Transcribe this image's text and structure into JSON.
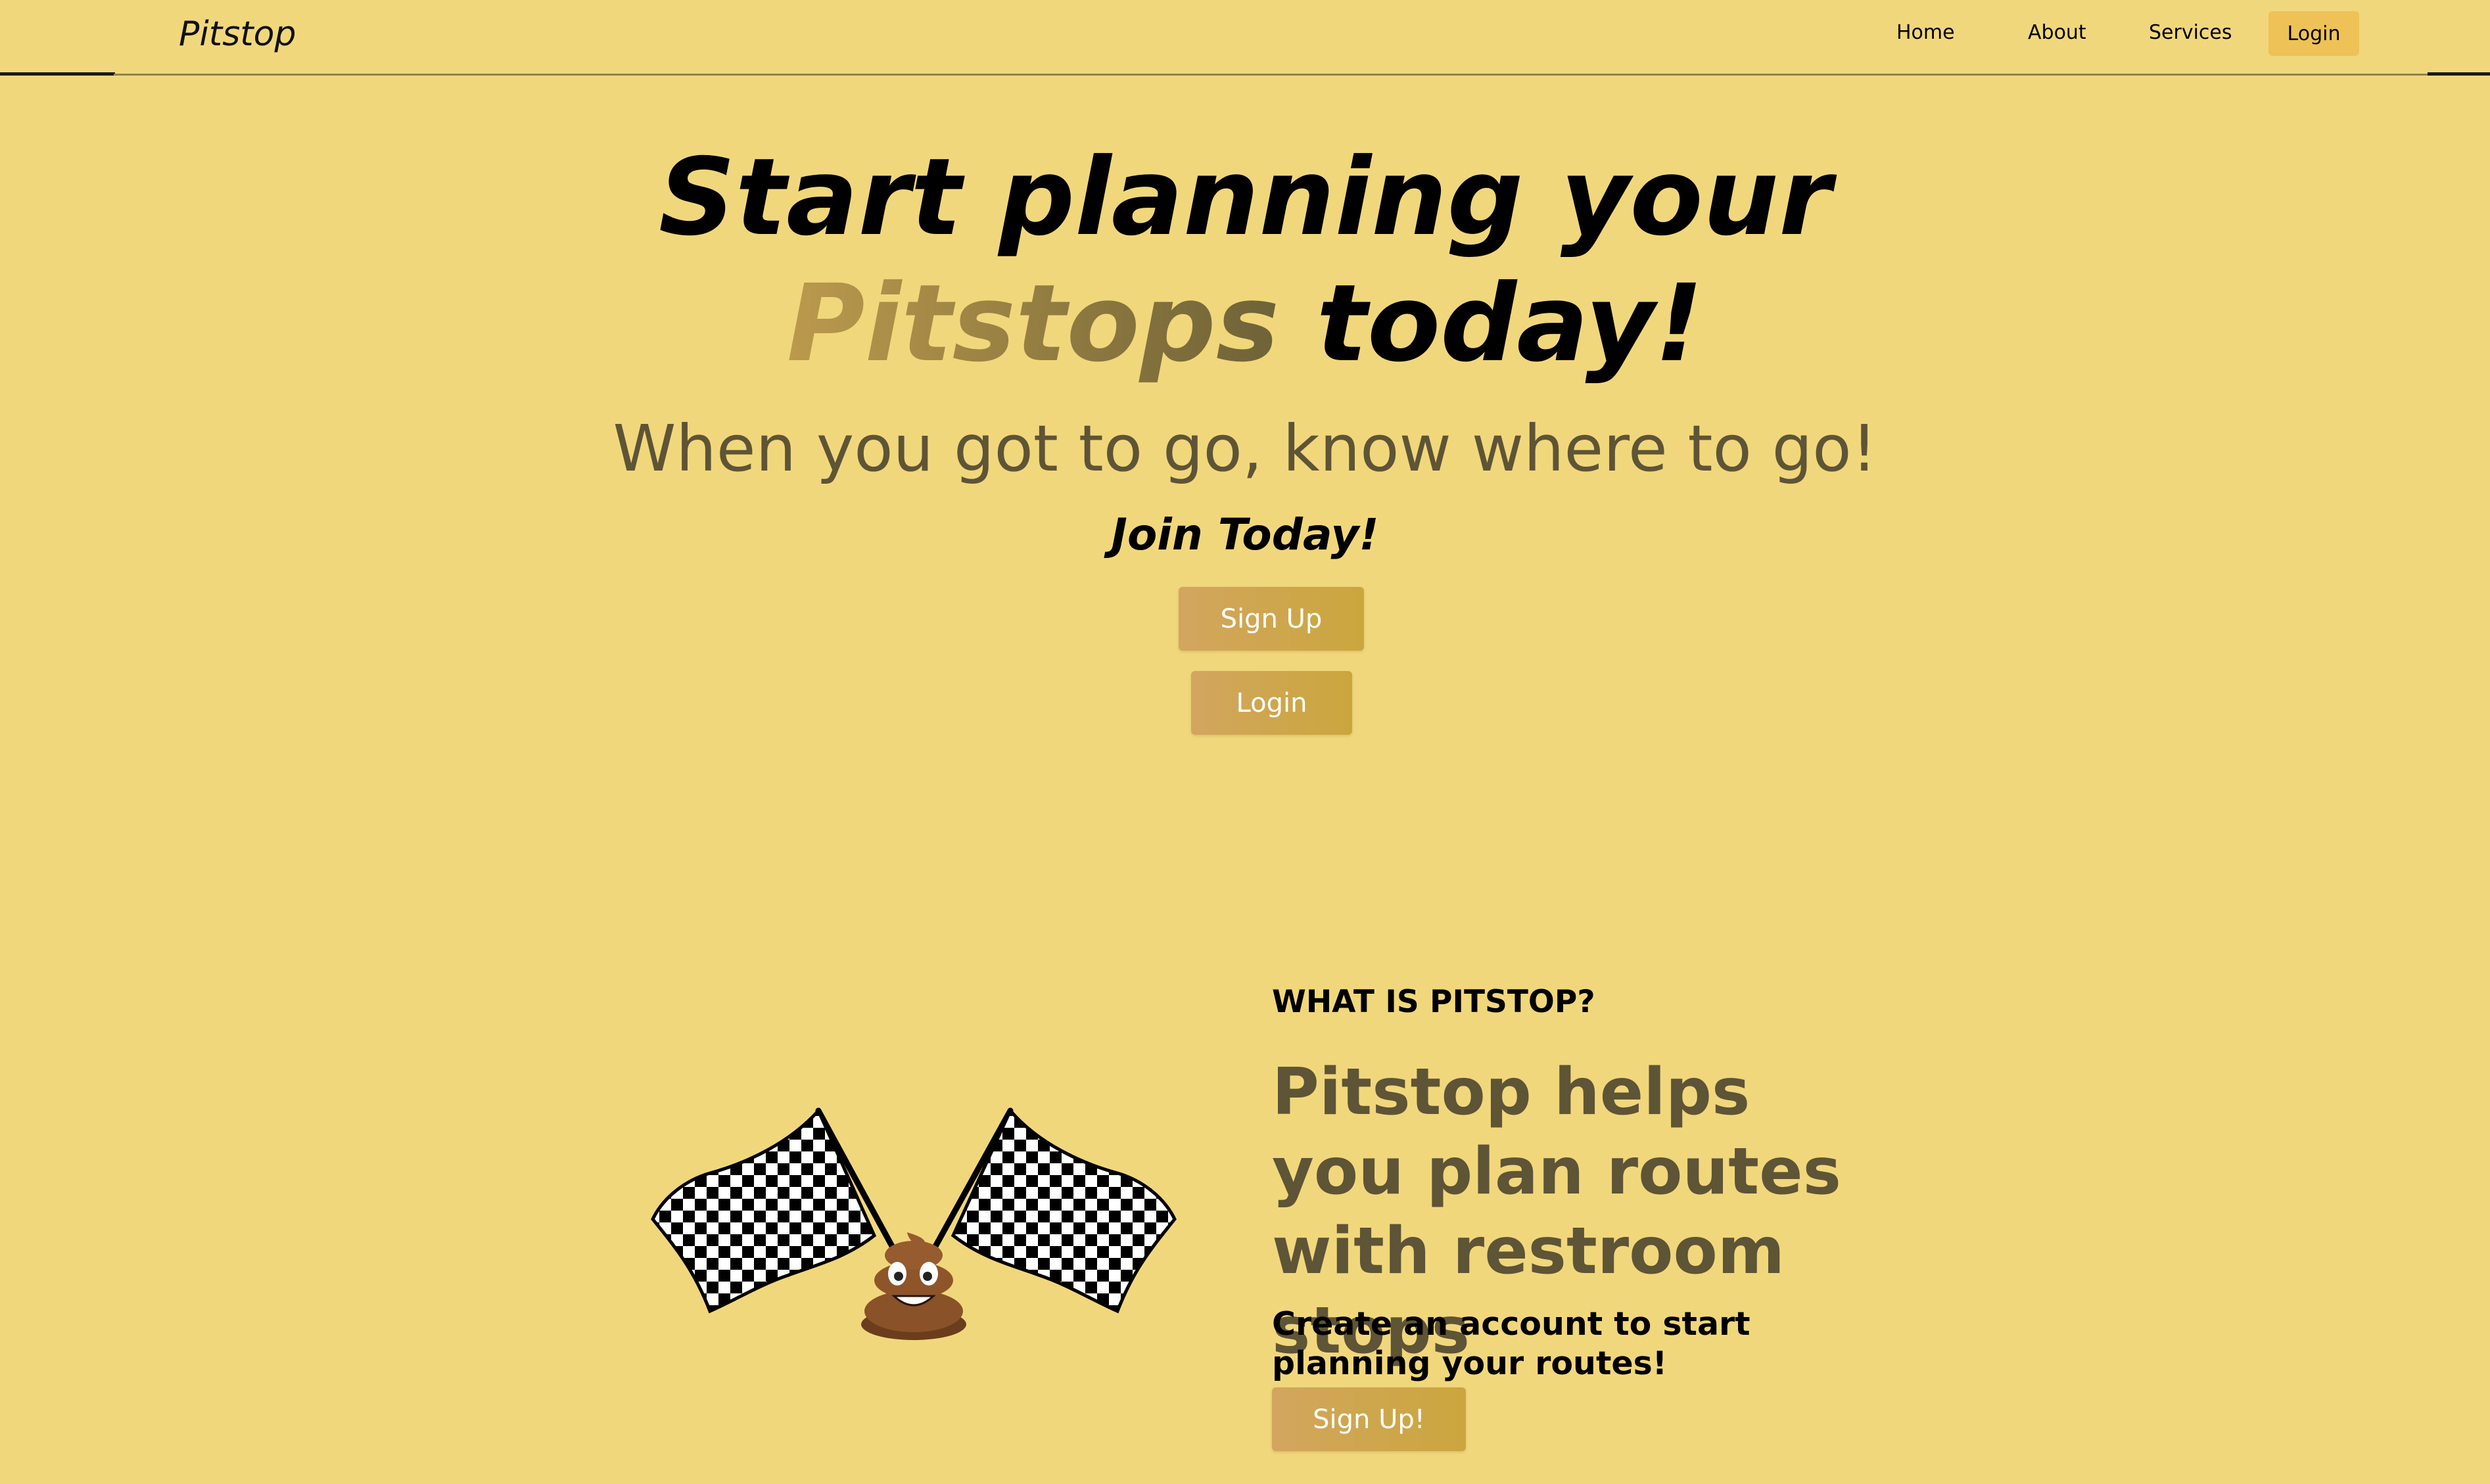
{
  "nav": {
    "brand": "Pitstop",
    "links": [
      "Home",
      "About",
      "Services"
    ],
    "login": "Login"
  },
  "hero": {
    "title_line1": "Start planning your",
    "title_accent": "Pitstops",
    "title_rest": " today!",
    "subtitle": "When you got to go, know where to go!",
    "join": "Join Today!",
    "signup_button": "Sign Up",
    "login_button": "Login"
  },
  "about": {
    "eyebrow": "WHAT IS PITSTOP?",
    "heading": "Pitstop helps you plan routes with restroom stops",
    "cta_text": "Create an account to start planning your routes!",
    "signup_button": "Sign Up!",
    "image_icons": [
      "checkered-flag-icon",
      "poop-emoji-icon"
    ]
  },
  "colors": {
    "background": "#f1d77c",
    "accent_text_start": "#bb9a4c",
    "accent_text_end": "#6e6237",
    "muted_text": "#5e5436",
    "button_start": "#d2a65f",
    "button_end": "#cba63d",
    "nav_login_bg": "#eec257"
  }
}
